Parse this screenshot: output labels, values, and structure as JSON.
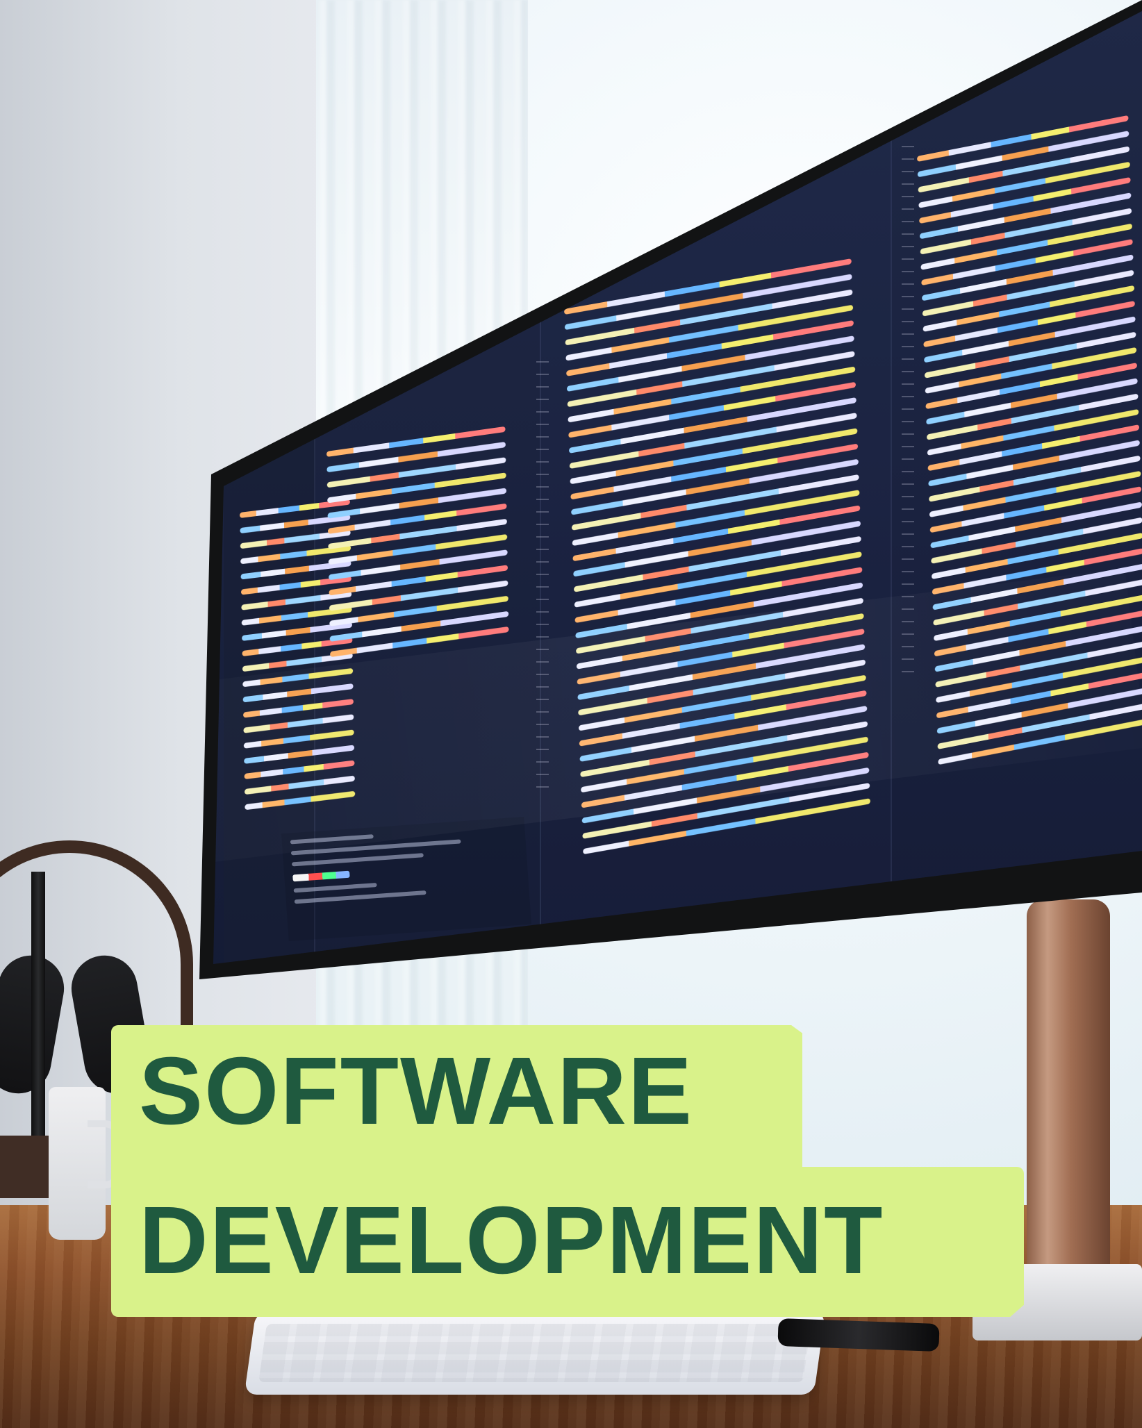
{
  "headline": {
    "line1": "SOFTWARE",
    "line2": "DEVELOPMENT"
  },
  "colors": {
    "headline_text": "#1f5a3f",
    "headline_bg": "#d9f28a",
    "screen_bg": "#1b2442",
    "desk": "#8e522c"
  },
  "icons": [
    "headphones-icon",
    "mug-icon",
    "keyboard-icon",
    "phone-icon"
  ]
}
